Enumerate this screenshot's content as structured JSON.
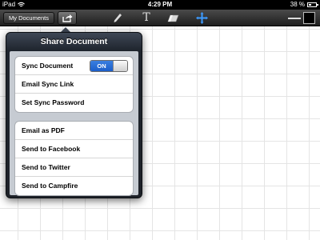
{
  "status_bar": {
    "device": "iPad",
    "time": "4:29 PM",
    "battery": "38 %"
  },
  "toolbar": {
    "documents_label": "My Documents",
    "text_tool_glyph": "T",
    "colors": {
      "stroke_color": "#000000"
    }
  },
  "popover": {
    "title": "Share Document",
    "sync_section": [
      {
        "label": "Sync Document"
      },
      {
        "label": "Email Sync Link"
      },
      {
        "label": "Set Sync Password"
      }
    ],
    "sync_toggle": {
      "value_label": "ON",
      "state": "on"
    },
    "share_section": [
      {
        "label": "Email as PDF"
      },
      {
        "label": "Send to Facebook"
      },
      {
        "label": "Send to Twitter"
      },
      {
        "label": "Send to Campfire"
      }
    ]
  },
  "icons": {
    "wifi": "wifi-icon",
    "battery": "battery-icon",
    "share": "share-arrow-icon",
    "pencil": "pencil-icon",
    "text": "text-tool-icon",
    "eraser": "eraser-icon",
    "move": "move-cross-icon"
  }
}
